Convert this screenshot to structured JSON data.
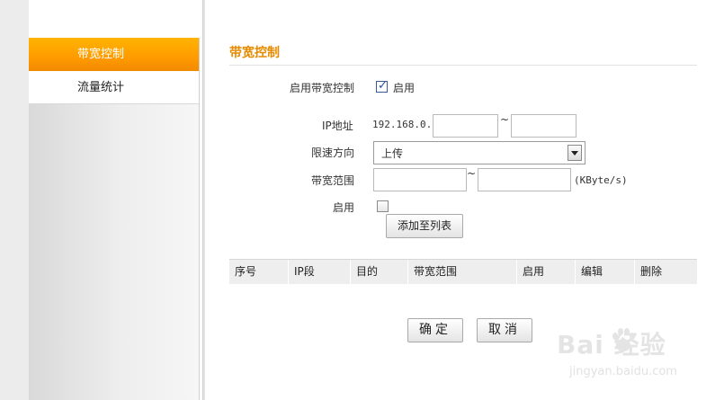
{
  "sidebar": {
    "items": [
      {
        "label": "带宽控制",
        "active": true
      },
      {
        "label": "流量统计",
        "active": false
      }
    ]
  },
  "main": {
    "title": "带宽控制",
    "enable_bandwidth": {
      "label": "启用带宽控制",
      "checked": true,
      "check_label": "启用"
    },
    "ip": {
      "label": "IP地址",
      "prefix": "192.168.0.",
      "start_value": "",
      "end_value": "",
      "separator": "~"
    },
    "direction": {
      "label": "限速方向",
      "selected": "上传"
    },
    "range": {
      "label": "带宽范围",
      "min_value": "",
      "max_value": "",
      "separator": "~",
      "unit": "(KByte/s)"
    },
    "rule_enable": {
      "label": "启用",
      "checked": false
    },
    "add_button": "添加至列表",
    "table": {
      "columns": [
        "序号",
        "IP段",
        "目的",
        "带宽范围",
        "启用",
        "编辑",
        "删除"
      ],
      "rows": []
    },
    "confirm_button": "确定",
    "cancel_button": "取消"
  },
  "watermark": {
    "brand": "Bai  经验",
    "url": "jingyan.baidu.com"
  },
  "colors": {
    "accent": "#ff9b00",
    "title": "#e68a00"
  }
}
